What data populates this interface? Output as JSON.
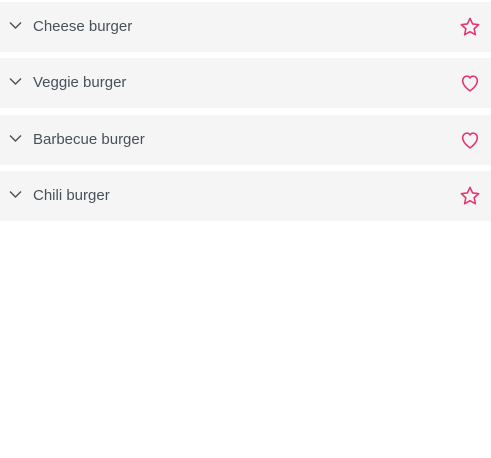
{
  "colors": {
    "panel_background": "#f5f5f5",
    "text": "#4a5058",
    "chevron": "#4a5058",
    "accent": "#e8336d"
  },
  "items": [
    {
      "label": "Cheese burger",
      "icon": "star-icon"
    },
    {
      "label": "Veggie burger",
      "icon": "heart-icon"
    },
    {
      "label": "Barbecue burger",
      "icon": "heart-icon"
    },
    {
      "label": "Chili burger",
      "icon": "star-icon"
    }
  ]
}
